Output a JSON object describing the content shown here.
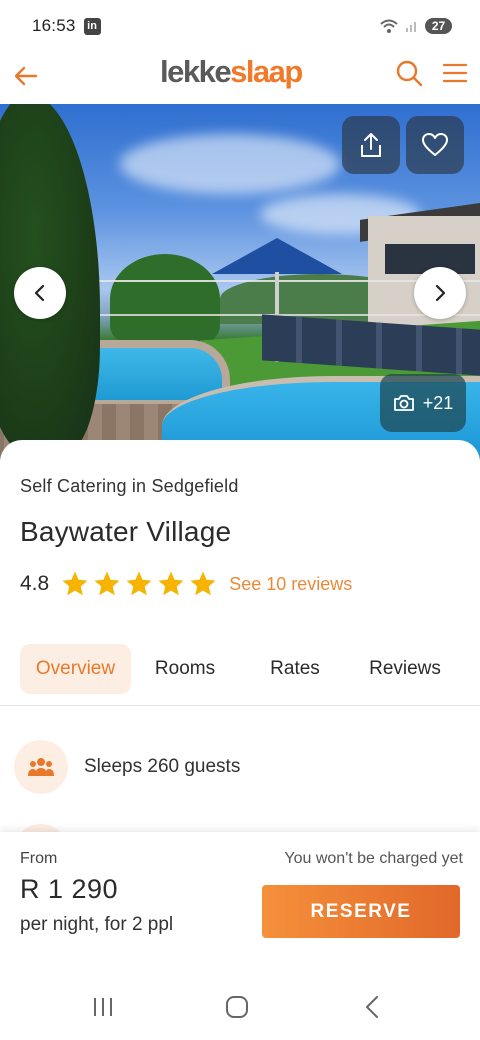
{
  "status_bar": {
    "time": "16:53",
    "notification_icon": "linkedin-icon",
    "battery_level": "27"
  },
  "header": {
    "logo_part1": "lekke",
    "logo_part2": "slaap",
    "brand_color": "#f07a2a"
  },
  "hero": {
    "photo_count": "+21"
  },
  "listing": {
    "category": "Self Catering in Sedgefield",
    "title": "Baywater Village",
    "rating": "4.8",
    "stars": 5,
    "reviews_link": "See 10 reviews"
  },
  "tabs": [
    {
      "label": "Overview",
      "active": true
    },
    {
      "label": "Rooms",
      "active": false
    },
    {
      "label": "Rates",
      "active": false
    },
    {
      "label": "Reviews",
      "active": false
    }
  ],
  "features": [
    {
      "icon": "guests-icon",
      "text": "Sleeps 260 guests"
    }
  ],
  "booking": {
    "from_label": "From",
    "price": "R 1 290",
    "per_night": "per night, for 2 ppl",
    "charge_note": "You won't be charged yet",
    "reserve_label": "RESERVE"
  },
  "colors": {
    "accent": "#e8792c",
    "accent_light": "#fdeee3",
    "star": "#f6b400"
  }
}
